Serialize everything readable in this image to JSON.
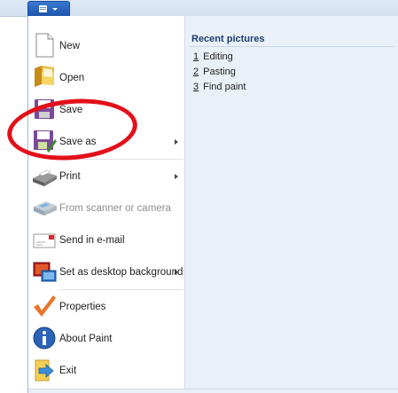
{
  "menu": {
    "items": [
      {
        "id": "new",
        "label": "New",
        "icon": "new-document-icon",
        "has_submenu": false,
        "disabled": false
      },
      {
        "id": "open",
        "label": "Open",
        "icon": "open-folder-icon",
        "has_submenu": false,
        "disabled": false
      },
      {
        "id": "save",
        "label": "Save",
        "icon": "save-disk-icon",
        "has_submenu": false,
        "disabled": false
      },
      {
        "id": "save-as",
        "label": "Save as",
        "icon": "save-as-icon",
        "has_submenu": true,
        "disabled": false
      },
      {
        "id": "print",
        "label": "Print",
        "icon": "printer-icon",
        "has_submenu": true,
        "disabled": false
      },
      {
        "id": "scanner",
        "label": "From scanner or camera",
        "icon": "scanner-icon",
        "has_submenu": false,
        "disabled": true
      },
      {
        "id": "email",
        "label": "Send in e-mail",
        "icon": "email-icon",
        "has_submenu": false,
        "disabled": false
      },
      {
        "id": "desktop-background",
        "label": "Set as desktop background",
        "icon": "desktop-background-icon",
        "has_submenu": true,
        "disabled": false
      },
      {
        "id": "properties",
        "label": "Properties",
        "icon": "checkmark-icon",
        "has_submenu": false,
        "disabled": false
      },
      {
        "id": "about",
        "label": "About Paint",
        "icon": "info-icon",
        "has_submenu": false,
        "disabled": false
      },
      {
        "id": "exit",
        "label": "Exit",
        "icon": "exit-icon",
        "has_submenu": false,
        "disabled": false
      }
    ]
  },
  "recent": {
    "header": "Recent pictures",
    "items": [
      {
        "num": "1",
        "label": "Editing"
      },
      {
        "num": "2",
        "label": "Pasting"
      },
      {
        "num": "3",
        "label": "Find paint"
      }
    ]
  },
  "annotation": {
    "color": "#e3101a",
    "target": "save-as"
  }
}
